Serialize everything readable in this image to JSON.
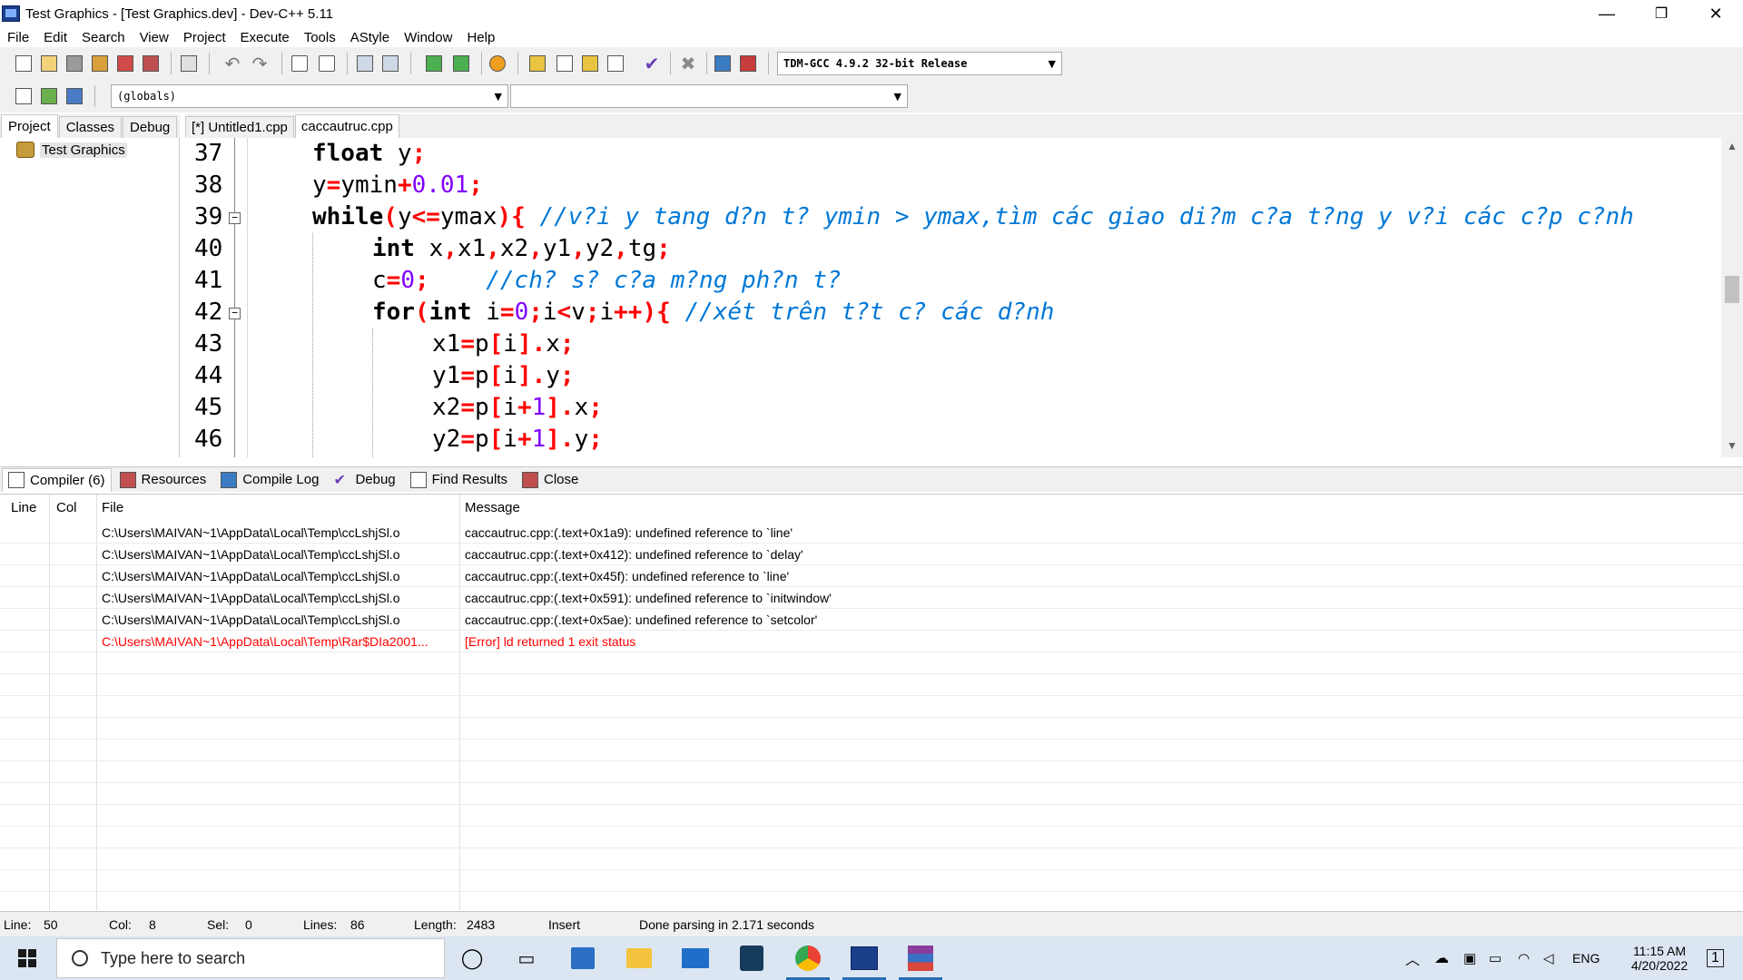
{
  "window": {
    "title": "Test Graphics - [Test Graphics.dev] - Dev-C++ 5.11",
    "minimize_glyph": "—",
    "restore_glyph": "❐",
    "close_glyph": "✕"
  },
  "menu": [
    "File",
    "Edit",
    "Search",
    "View",
    "Project",
    "Execute",
    "Tools",
    "AStyle",
    "Window",
    "Help"
  ],
  "toolbar": {
    "compiler_select": "TDM-GCC 4.9.2 32-bit Release",
    "scope_select": "(globals)",
    "function_select": ""
  },
  "left_panel": {
    "tabs": [
      "Project",
      "Classes",
      "Debug"
    ],
    "tree_root": "Test Graphics"
  },
  "editor": {
    "tabs": [
      "[*] Untitled1.cpp",
      "caccautruc.cpp"
    ],
    "active_tab": "caccautruc.cpp",
    "line_numbers": [
      "37",
      "38",
      "39",
      "40",
      "41",
      "42",
      "43",
      "44",
      "45",
      "46"
    ]
  },
  "bottom_tabs": [
    "Compiler (6)",
    "Resources",
    "Compile Log",
    "Debug",
    "Find Results",
    "Close"
  ],
  "compiler_table": {
    "headers": {
      "line": "Line",
      "col": "Col",
      "file": "File",
      "message": "Message"
    },
    "rows": [
      {
        "file": "C:\\Users\\MAIVAN~1\\AppData\\Local\\Temp\\ccLshjSl.o",
        "message": "caccautruc.cpp:(.text+0x1a9): undefined reference to `line'"
      },
      {
        "file": "C:\\Users\\MAIVAN~1\\AppData\\Local\\Temp\\ccLshjSl.o",
        "message": "caccautruc.cpp:(.text+0x412): undefined reference to `delay'"
      },
      {
        "file": "C:\\Users\\MAIVAN~1\\AppData\\Local\\Temp\\ccLshjSl.o",
        "message": "caccautruc.cpp:(.text+0x45f): undefined reference to `line'"
      },
      {
        "file": "C:\\Users\\MAIVAN~1\\AppData\\Local\\Temp\\ccLshjSl.o",
        "message": "caccautruc.cpp:(.text+0x591): undefined reference to `initwindow'"
      },
      {
        "file": "C:\\Users\\MAIVAN~1\\AppData\\Local\\Temp\\ccLshjSl.o",
        "message": "caccautruc.cpp:(.text+0x5ae): undefined reference to `setcolor'"
      },
      {
        "file": "C:\\Users\\MAIVAN~1\\AppData\\Local\\Temp\\Rar$DIa2001...",
        "message": "[Error] ld returned 1 exit status"
      }
    ]
  },
  "status": {
    "line_label": "Line:",
    "line_value": "50",
    "col_label": "Col:",
    "col_value": "8",
    "sel_label": "Sel:",
    "sel_value": "0",
    "lines_label": "Lines:",
    "lines_value": "86",
    "length_label": "Length:",
    "length_value": "2483",
    "mode": "Insert",
    "message": "Done parsing in 2.171 seconds"
  },
  "taskbar": {
    "search_placeholder": "Type here to search",
    "language": "ENG",
    "time": "11:15 AM",
    "date": "4/20/2022",
    "notification_count": "1"
  },
  "colors": {
    "keyword": "#000000",
    "operator": "#ff0000",
    "number": "#8000ff",
    "comment": "#0078d7",
    "error_text": "#ff0000"
  }
}
